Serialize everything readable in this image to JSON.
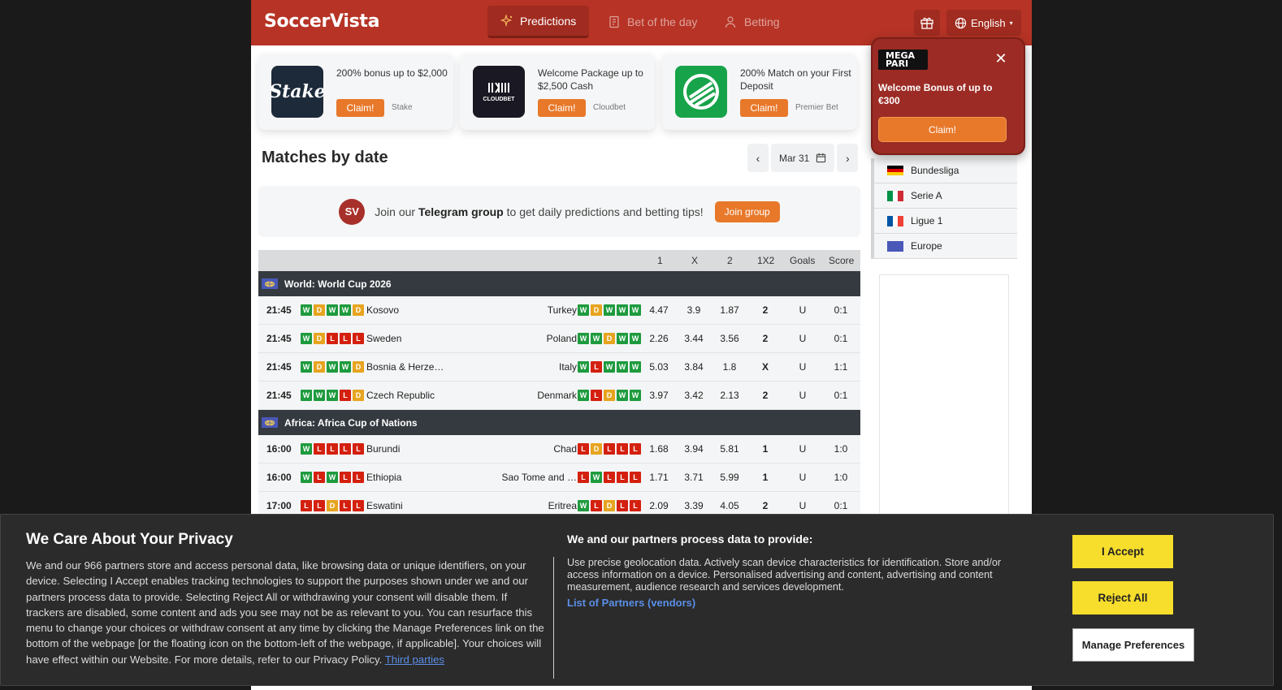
{
  "header": {
    "logo": "SoccerVista",
    "nav": [
      {
        "label": "Predictions",
        "icon": "sparkle-icon",
        "active": true
      },
      {
        "label": "Bet of the day",
        "icon": "document-icon",
        "active": false
      },
      {
        "label": "Betting",
        "icon": "user-icon",
        "active": false
      }
    ],
    "language": "English",
    "colors": {
      "brand": "#b63325",
      "accent": "#e8782a"
    }
  },
  "promos": [
    {
      "text": "200% bonus up to $2,000",
      "claim": "Claim!",
      "brand": "Stake",
      "logo_text": "Stake"
    },
    {
      "text": "Welcome Package up to $2,500 Cash",
      "claim": "Claim!",
      "brand": "Cloudbet",
      "logo_text": "CLOUDBET"
    },
    {
      "text": "200% Match on your First Deposit",
      "claim": "Claim!",
      "brand": "Premier Bet",
      "logo_text": ""
    }
  ],
  "matches": {
    "title": "Matches by date",
    "date": "Mar 31",
    "telegram": {
      "avatar": "SV",
      "prefix": "Join our",
      "bold": "Telegram group",
      "suffix": "to get daily predictions and betting tips!",
      "button": "Join group"
    },
    "columns": [
      "1",
      "X",
      "2",
      "1X2",
      "Goals",
      "Score"
    ],
    "leagues": [
      {
        "name": "World: World Cup 2026",
        "rows": [
          {
            "time": "21:45",
            "home_form": [
              "W",
              "D",
              "W",
              "W",
              "D"
            ],
            "home": "Kosovo",
            "away": "Turkey",
            "away_form": [
              "W",
              "D",
              "W",
              "W",
              "W"
            ],
            "o1": "4.47",
            "ox": "3.9",
            "o2": "1.87",
            "pick": "2",
            "goals": "U",
            "score": "0:1"
          },
          {
            "time": "21:45",
            "home_form": [
              "W",
              "D",
              "L",
              "L",
              "L"
            ],
            "home": "Sweden",
            "away": "Poland",
            "away_form": [
              "W",
              "W",
              "D",
              "W",
              "W"
            ],
            "o1": "2.26",
            "ox": "3.44",
            "o2": "3.56",
            "pick": "2",
            "goals": "U",
            "score": "0:1"
          },
          {
            "time": "21:45",
            "home_form": [
              "W",
              "D",
              "W",
              "W",
              "D"
            ],
            "home": "Bosnia & Herze…",
            "away": "Italy",
            "away_form": [
              "W",
              "L",
              "W",
              "W",
              "W"
            ],
            "o1": "5.03",
            "ox": "3.84",
            "o2": "1.8",
            "pick": "X",
            "goals": "U",
            "score": "1:1"
          },
          {
            "time": "21:45",
            "home_form": [
              "W",
              "W",
              "W",
              "L",
              "D"
            ],
            "home": "Czech Republic",
            "away": "Denmark",
            "away_form": [
              "W",
              "L",
              "D",
              "W",
              "W"
            ],
            "o1": "3.97",
            "ox": "3.42",
            "o2": "2.13",
            "pick": "2",
            "goals": "U",
            "score": "0:1"
          }
        ]
      },
      {
        "name": "Africa: Africa Cup of Nations",
        "rows": [
          {
            "time": "16:00",
            "home_form": [
              "W",
              "L",
              "L",
              "L",
              "L"
            ],
            "home": "Burundi",
            "away": "Chad",
            "away_form": [
              "L",
              "D",
              "L",
              "L",
              "L"
            ],
            "o1": "1.68",
            "ox": "3.94",
            "o2": "5.81",
            "pick": "1",
            "goals": "U",
            "score": "1:0"
          },
          {
            "time": "16:00",
            "home_form": [
              "W",
              "L",
              "W",
              "L",
              "L"
            ],
            "home": "Ethiopia",
            "away": "Sao Tome and …",
            "away_form": [
              "L",
              "W",
              "L",
              "L",
              "L"
            ],
            "o1": "1.71",
            "ox": "3.71",
            "o2": "5.99",
            "pick": "1",
            "goals": "U",
            "score": "1:0"
          },
          {
            "time": "17:00",
            "home_form": [
              "L",
              "L",
              "D",
              "L",
              "L"
            ],
            "home": "Eswatini",
            "away": "Eritrea",
            "away_form": [
              "W",
              "L",
              "D",
              "L",
              "L"
            ],
            "o1": "2.09",
            "ox": "3.39",
            "o2": "4.05",
            "pick": "2",
            "goals": "U",
            "score": "0:1"
          }
        ]
      }
    ]
  },
  "sidebar": {
    "leagues": [
      {
        "name": "Bundesliga",
        "flag": "germany-flag-icon",
        "colors": [
          "#000000",
          "#dd0000",
          "#ffce00"
        ],
        "dir": "h"
      },
      {
        "name": "Serie A",
        "flag": "italy-flag-icon",
        "colors": [
          "#009246",
          "#ffffff",
          "#ce2b37"
        ],
        "dir": "v"
      },
      {
        "name": "Ligue 1",
        "flag": "france-flag-icon",
        "colors": [
          "#0055a4",
          "#ffffff",
          "#ef4135"
        ],
        "dir": "v"
      },
      {
        "name": "Europe",
        "flag": "world-flag-icon",
        "colors": [
          "#4a58b8"
        ],
        "dir": "v"
      }
    ]
  },
  "popup": {
    "logo_line1": "MEGA",
    "logo_line2": "PARI",
    "text": "Welcome Bonus of up to €300",
    "claim": "Claim!"
  },
  "cookie": {
    "title": "We Care About Your Privacy",
    "body": "We and our 966 partners store and access personal data, like browsing data or unique identifiers, on your device. Selecting I Accept enables tracking technologies to support the purposes shown under we and our partners process data to provide. Selecting Reject All or withdrawing your consent will disable them. If trackers are disabled, some content and ads you see may not be as relevant to you. You can resurface this menu to change your choices or withdraw consent at any time by clicking the Manage Preferences link on the bottom of the webpage [or the floating icon on the bottom-left of the webpage, if applicable]. Your choices will have effect within our Website. For more details, refer to our Privacy Policy.",
    "third_parties": "Third parties",
    "title2": "We and our partners process data to provide:",
    "body2": "Use precise geolocation data. Actively scan device characteristics for identification. Store and/or access information on a device. Personalised advertising and content, advertising and content measurement, audience research and services development.",
    "partners_link": "List of Partners (vendors)",
    "accept": "I Accept",
    "reject": "Reject All",
    "manage": "Manage Preferences"
  }
}
